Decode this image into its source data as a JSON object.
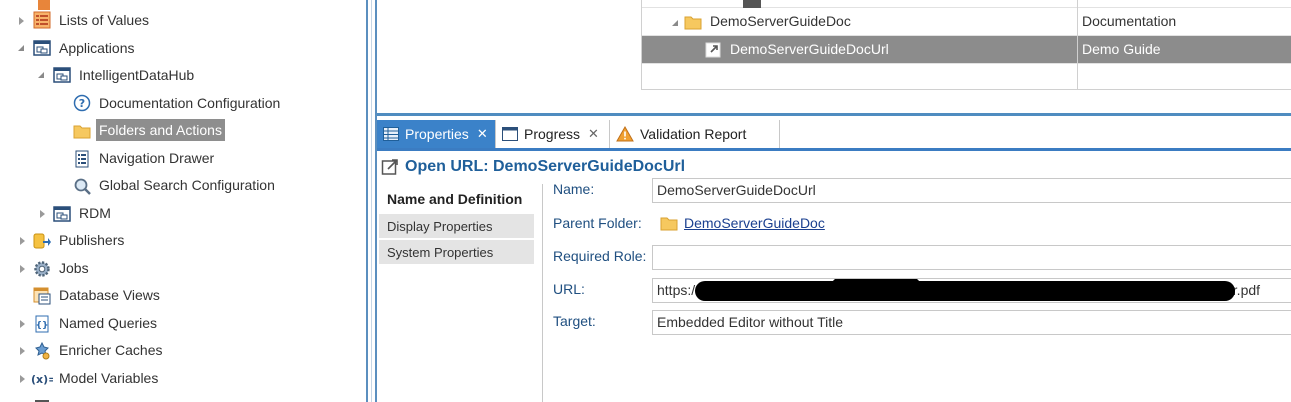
{
  "tree": {
    "items": [
      {
        "label": "Lists of Values",
        "icon": "list-of-values-icon",
        "toggle": "closed"
      },
      {
        "label": "Applications",
        "icon": "application-icon",
        "toggle": "open"
      },
      {
        "label": "IntelligentDataHub",
        "icon": "application-icon",
        "toggle": "open"
      },
      {
        "label": "Documentation Configuration",
        "icon": "help-icon",
        "toggle": "none"
      },
      {
        "label": "Folders and Actions",
        "icon": "folder-icon",
        "toggle": "none",
        "selected": true
      },
      {
        "label": "Navigation Drawer",
        "icon": "navigation-drawer-icon",
        "toggle": "none"
      },
      {
        "label": "Global Search Configuration",
        "icon": "search-config-icon",
        "toggle": "none"
      },
      {
        "label": "RDM",
        "icon": "application-icon",
        "toggle": "closed"
      },
      {
        "label": "Publishers",
        "icon": "publisher-icon",
        "toggle": "closed"
      },
      {
        "label": "Jobs",
        "icon": "gear-icon",
        "toggle": "closed"
      },
      {
        "label": "Database Views",
        "icon": "database-view-icon",
        "toggle": "none"
      },
      {
        "label": "Named Queries",
        "icon": "named-query-icon",
        "toggle": "closed"
      },
      {
        "label": "Enricher Caches",
        "icon": "enricher-icon",
        "toggle": "closed"
      },
      {
        "label": "Model Variables",
        "icon": "variable-icon",
        "toggle": "closed"
      }
    ]
  },
  "grid": {
    "rows": [
      {
        "name": "DemoServerGuideDoc",
        "value": "Documentation",
        "icon": "folder-icon"
      },
      {
        "name": "DemoServerGuideDocUrl",
        "value": "Demo Guide",
        "icon": "open-url-icon",
        "selected": true
      }
    ]
  },
  "tabs": [
    {
      "label": "Properties",
      "icon": "properties-icon",
      "active": true
    },
    {
      "label": "Progress",
      "icon": "progress-icon",
      "active": false
    },
    {
      "label": "Validation Report",
      "icon": "warning-icon",
      "active": false
    }
  ],
  "properties": {
    "title": "Open URL: DemoServerGuideDocUrl",
    "sections": [
      "Name and Definition",
      "Display Properties",
      "System Properties"
    ],
    "fields": {
      "name_label": "Name:",
      "name_value": "DemoServerGuideDocUrl",
      "parent_label": "Parent Folder:",
      "parent_value": "DemoServerGuideDoc",
      "role_label": "Required Role:",
      "role_value": "",
      "url_label": "URL:",
      "url_prefix": "https:/",
      "url_suffix": "er.pdf",
      "target_label": "Target:",
      "target_value": "Embedded Editor without Title"
    }
  },
  "colors": {
    "accent": "#3b82c9",
    "selection": "#8c8c8c",
    "label": "#1f4f80",
    "title": "#1f5f9a"
  }
}
